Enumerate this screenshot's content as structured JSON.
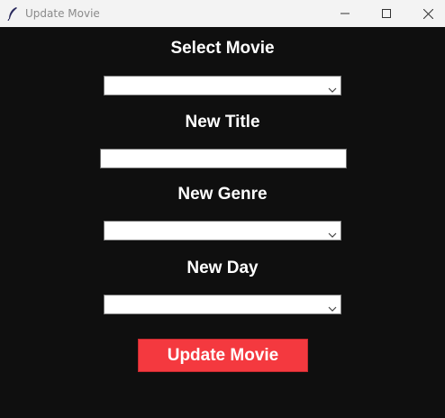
{
  "window": {
    "title": "Update Movie",
    "icons": {
      "app": "feather-icon",
      "minimize": "minimize-icon",
      "maximize": "maximize-icon",
      "close": "close-icon"
    }
  },
  "form": {
    "select_movie": {
      "label": "Select Movie",
      "value": ""
    },
    "new_title": {
      "label": "New Title",
      "value": ""
    },
    "new_genre": {
      "label": "New Genre",
      "value": ""
    },
    "new_day": {
      "label": "New Day",
      "value": ""
    },
    "submit_label": "Update Movie"
  },
  "colors": {
    "background": "#0f0f0f",
    "titlebar": "#f3f3f3",
    "button": "#f4393f",
    "label_text": "#ffffff"
  }
}
